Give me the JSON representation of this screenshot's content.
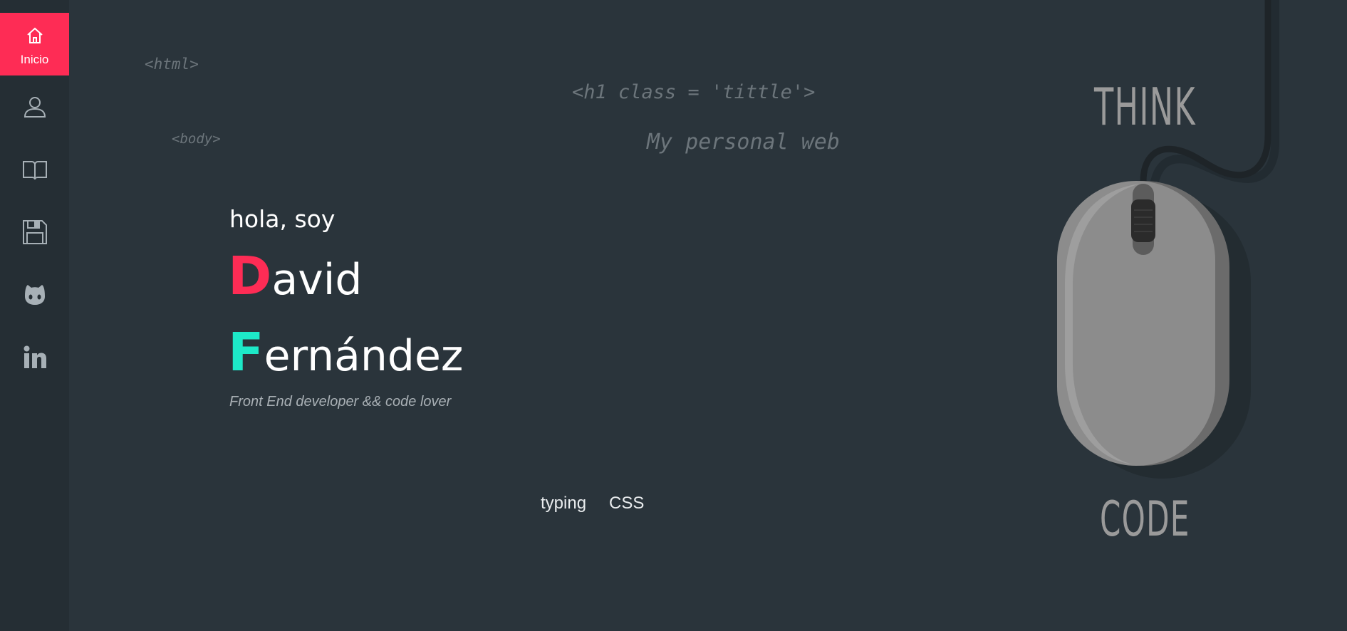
{
  "sidebar": {
    "items": [
      {
        "id": "home",
        "label": "Inicio",
        "icon": "home-icon",
        "active": true
      },
      {
        "id": "about",
        "label": "",
        "icon": "user-icon",
        "active": false
      },
      {
        "id": "portfolio",
        "label": "",
        "icon": "book-icon",
        "active": false
      },
      {
        "id": "save",
        "label": "",
        "icon": "floppy-disk-icon",
        "active": false
      },
      {
        "id": "github",
        "label": "",
        "icon": "github-icon",
        "active": false
      },
      {
        "id": "linkedin",
        "label": "",
        "icon": "linkedin-icon",
        "active": false
      }
    ]
  },
  "code_comments": {
    "html_tag": "<html>",
    "body_tag": "<body>",
    "h1_tag": "<h1 class = 'tittle'>",
    "h1_text": "My personal web"
  },
  "hero": {
    "greeting": "hola, soy",
    "first_name_initial": "D",
    "first_name_rest": "avid",
    "last_name_initial": "F",
    "last_name_rest": "ernández",
    "tagline": "Front End developer && code lover"
  },
  "tags": [
    "typing",
    "CSS"
  ],
  "mouse": {
    "top_word": "THINK",
    "bottom_word": "CODE"
  },
  "colors": {
    "background": "#2a343b",
    "sidebar": "#252e34",
    "accent_pink": "#fe2c55",
    "accent_cyan": "#1de9c8"
  }
}
